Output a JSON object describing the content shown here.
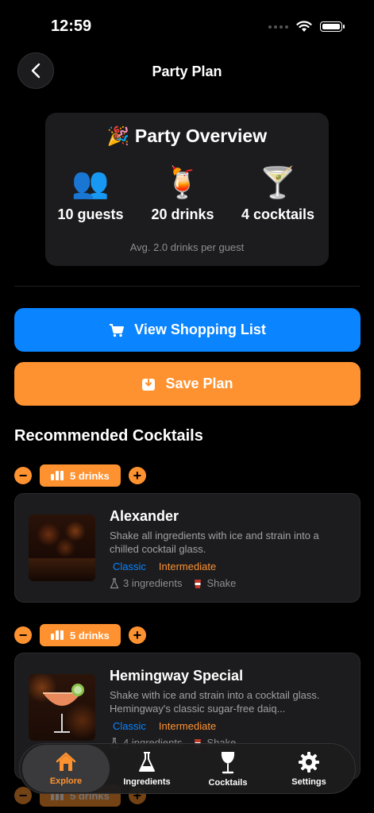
{
  "status_bar": {
    "time": "12:59"
  },
  "header": {
    "title": "Party Plan"
  },
  "overview": {
    "title": "🎉 Party Overview",
    "stats": [
      {
        "icon": "guests-icon",
        "emoji": "👥",
        "label": "10 guests"
      },
      {
        "icon": "tropical-drink-icon",
        "emoji": "🍹",
        "label": "20 drinks"
      },
      {
        "icon": "cocktail-glass-icon",
        "emoji": "🍸",
        "label": "4 cocktails"
      }
    ],
    "avg": "Avg. 2.0 drinks per guest"
  },
  "actions": {
    "shopping_list": "View Shopping List",
    "save_plan": "Save Plan"
  },
  "recommended": {
    "title": "Recommended Cocktails",
    "items": [
      {
        "drinks": "5 drinks",
        "name": "Alexander",
        "description": "Shake all ingredients with ice and strain into a chilled cocktail glass.",
        "category": "Classic",
        "difficulty": "Intermediate",
        "ingredients": "3 ingredients",
        "method": "Shake"
      },
      {
        "drinks": "5 drinks",
        "name": "Hemingway Special",
        "description": "Shake with ice and strain into a cocktail glass. Hemingway's classic sugar-free daiq...",
        "category": "Classic",
        "difficulty": "Intermediate",
        "ingredients": "4 ingredients",
        "method": "Shake"
      },
      {
        "drinks": "5 drinks"
      }
    ]
  },
  "tabbar": {
    "tabs": [
      {
        "label": "Explore",
        "icon": "house-icon",
        "active": true
      },
      {
        "label": "Ingredients",
        "icon": "flask-icon",
        "active": false
      },
      {
        "label": "Cocktails",
        "icon": "wine-glass-icon",
        "active": false
      },
      {
        "label": "Settings",
        "icon": "gear-icon",
        "active": false
      }
    ]
  },
  "colors": {
    "accent_orange": "#ff9230",
    "accent_blue": "#0a84ff",
    "card_bg": "#1c1c1e"
  }
}
